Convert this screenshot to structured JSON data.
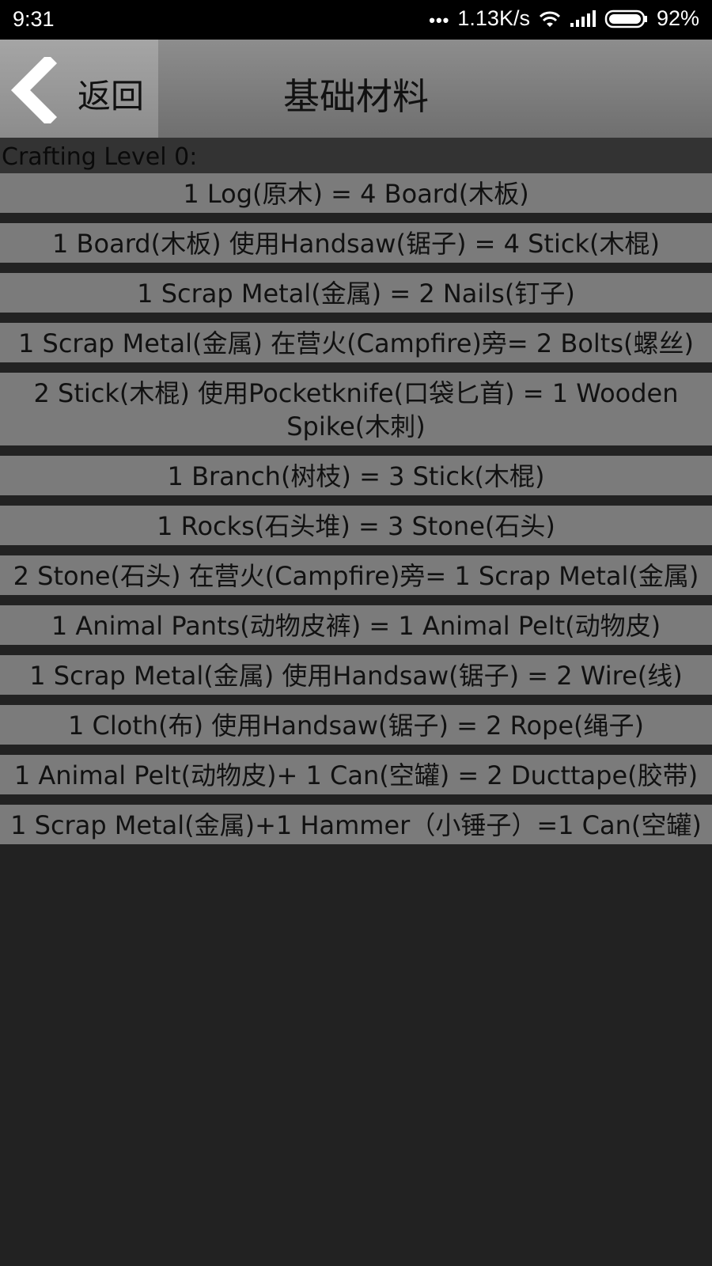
{
  "status_bar": {
    "time": "9:31",
    "dots": "•••",
    "speed": "1.13K/s",
    "battery": "92%"
  },
  "header": {
    "back_label": "返回",
    "title": "基础材料"
  },
  "section": {
    "label": "Crafting Level 0:"
  },
  "recipes": [
    "1 Log(原木) = 4 Board(木板)",
    "1 Board(木板) 使用Handsaw(锯子) = 4 Stick(木棍)",
    "1 Scrap Metal(金属) = 2 Nails(钉子)",
    "1 Scrap Metal(金属) 在营火(Campfire)旁= 2 Bolts(螺丝)",
    "2 Stick(木棍) 使用Pocketknife(口袋匕首) = 1 Wooden Spike(木刺)",
    "1 Branch(树枝) = 3 Stick(木棍)",
    "1 Rocks(石头堆) = 3 Stone(石头)",
    "2 Stone(石头) 在营火(Campfire)旁= 1 Scrap Metal(金属)",
    "1 Animal Pants(动物皮裤) = 1 Animal Pelt(动物皮)",
    "1 Scrap Metal(金属) 使用Handsaw(锯子) = 2 Wire(线)",
    "1 Cloth(布) 使用Handsaw(锯子) = 2 Rope(绳子)",
    "1 Animal Pelt(动物皮)+ 1 Can(空罐) = 2 Ducttape(胶带)",
    "1 Scrap Metal(金属)+1 Hammer（小锤子）=1 Can(空罐)"
  ]
}
